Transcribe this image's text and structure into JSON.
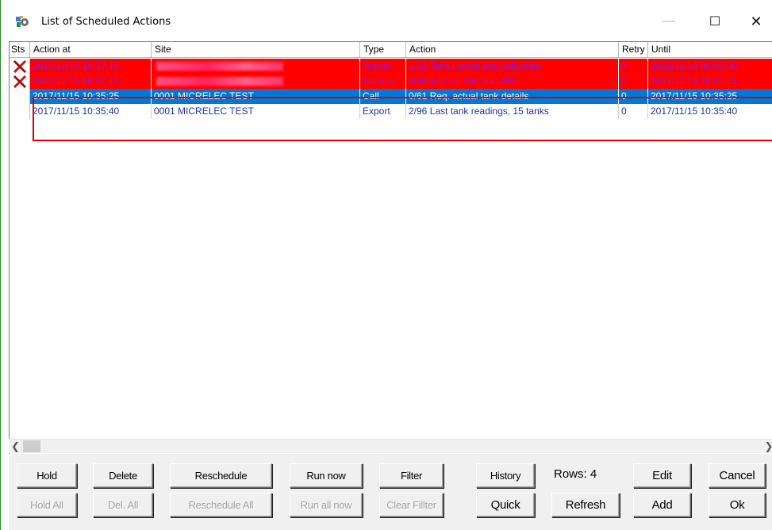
{
  "window": {
    "title": "List of Scheduled Actions",
    "icon": "app-gear-icon",
    "controls": {
      "minimize": "—",
      "maximize": "☐",
      "close": "✕"
    }
  },
  "grid": {
    "columns": [
      "Sts",
      "Action at",
      "Site",
      "Type",
      "Action",
      "Retry",
      "Until"
    ],
    "rows": [
      {
        "status": "error-x-icon",
        "action_at": "2017/11/14  15:37:15",
        "site": "",
        "type": "Report",
        "action": "1/82  Tank Levels and deliveries",
        "retry": "0",
        "until": "2019/11/14  00:00:00",
        "state": "error"
      },
      {
        "status": "error-x-icon",
        "action_at": "2017/11/14  15:37:15",
        "site": "",
        "type": "Service",
        "action": "4/80  Access Site via LMS",
        "retry": "0",
        "until": "2017/11/14  15:37:15",
        "state": "error"
      },
      {
        "status": "",
        "action_at": "2017/11/15  10:35:25",
        "site": "0001  MICRELEC TEST",
        "type": "Call",
        "action": "0/61  Req. actual tank details",
        "retry": "0",
        "until": "2017/11/15  10:35:25",
        "state": "selected"
      },
      {
        "status": "",
        "action_at": "2017/11/15  10:35:40",
        "site": "0001  MICRELEC TEST",
        "type": "Export",
        "action": "2/96  Last tank readings, 15 tanks",
        "retry": "0",
        "until": "2017/11/15  10:35:40",
        "state": "normal"
      }
    ]
  },
  "buttons": {
    "hold": "Hold",
    "hold_all": "Hold All",
    "delete": "Delete",
    "del_all": "Del. All",
    "reschedule": "Reschedule",
    "reschedule_all": "Reschedule  All",
    "run_now": "Run now",
    "run_all_now": "Run all now",
    "filter": "Filter",
    "clear_filter": "Clear Fillter",
    "history": "History",
    "quick": "Quick",
    "refresh": "Refresh",
    "edit": "Edit",
    "add": "Add",
    "cancel": "Cancel",
    "ok": "Ok"
  },
  "rows_label": "Rows:  4",
  "colors": {
    "error_row": "#ff0000",
    "selected_row": "#0078d7",
    "highlight_box": "#e00000",
    "text_blue": "#2233aa"
  }
}
